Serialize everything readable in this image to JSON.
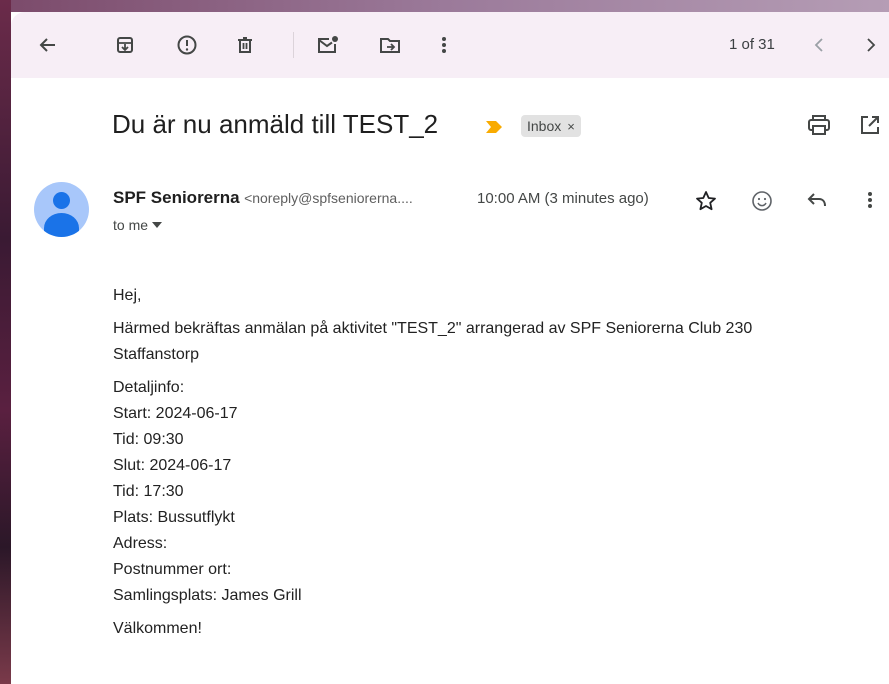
{
  "toolbar": {
    "back_icon": "arrow-left-icon",
    "archive_icon": "archive-icon",
    "report_icon": "report-spam-icon",
    "delete_icon": "trash-icon",
    "mark_unread_icon": "mark-unread-icon",
    "move_icon": "move-to-icon",
    "more_icon": "more-vert-icon",
    "page_count": "1 of 31",
    "prev_icon": "chevron-left-icon",
    "next_icon": "chevron-right-icon"
  },
  "message": {
    "subject": "Du är nu anmäld till TEST_2",
    "label": "Inbox",
    "label_close": "×",
    "sender_name": "SPF Seniorerna",
    "sender_email": "<noreply@spfseniorerna....",
    "time": "10:00 AM (3 minutes ago)",
    "to": "to me",
    "body": {
      "greeting": "Hej,",
      "intro_1": "Härmed bekräftas anmälan på aktivitet \"TEST_2\" arrangerad av SPF Seniorerna Club 230",
      "intro_2": "Staffanstorp",
      "details": [
        "Detaljinfo:",
        "Start: 2024-06-17",
        "Tid: 09:30",
        "Slut: 2024-06-17",
        "Tid: 17:30",
        "Plats: Bussutflykt",
        "Adress:",
        "Postnummer ort:",
        "Samlingsplats: James Grill"
      ],
      "closing": "Välkommen!"
    }
  },
  "colors": {
    "toolbar_bg": "#f7eef6",
    "importance_marker": "#f9ab00",
    "chip_bg": "#e2e2e2",
    "avatar_bg": "#a8c7fa",
    "avatar_fg": "#1a73e8"
  }
}
